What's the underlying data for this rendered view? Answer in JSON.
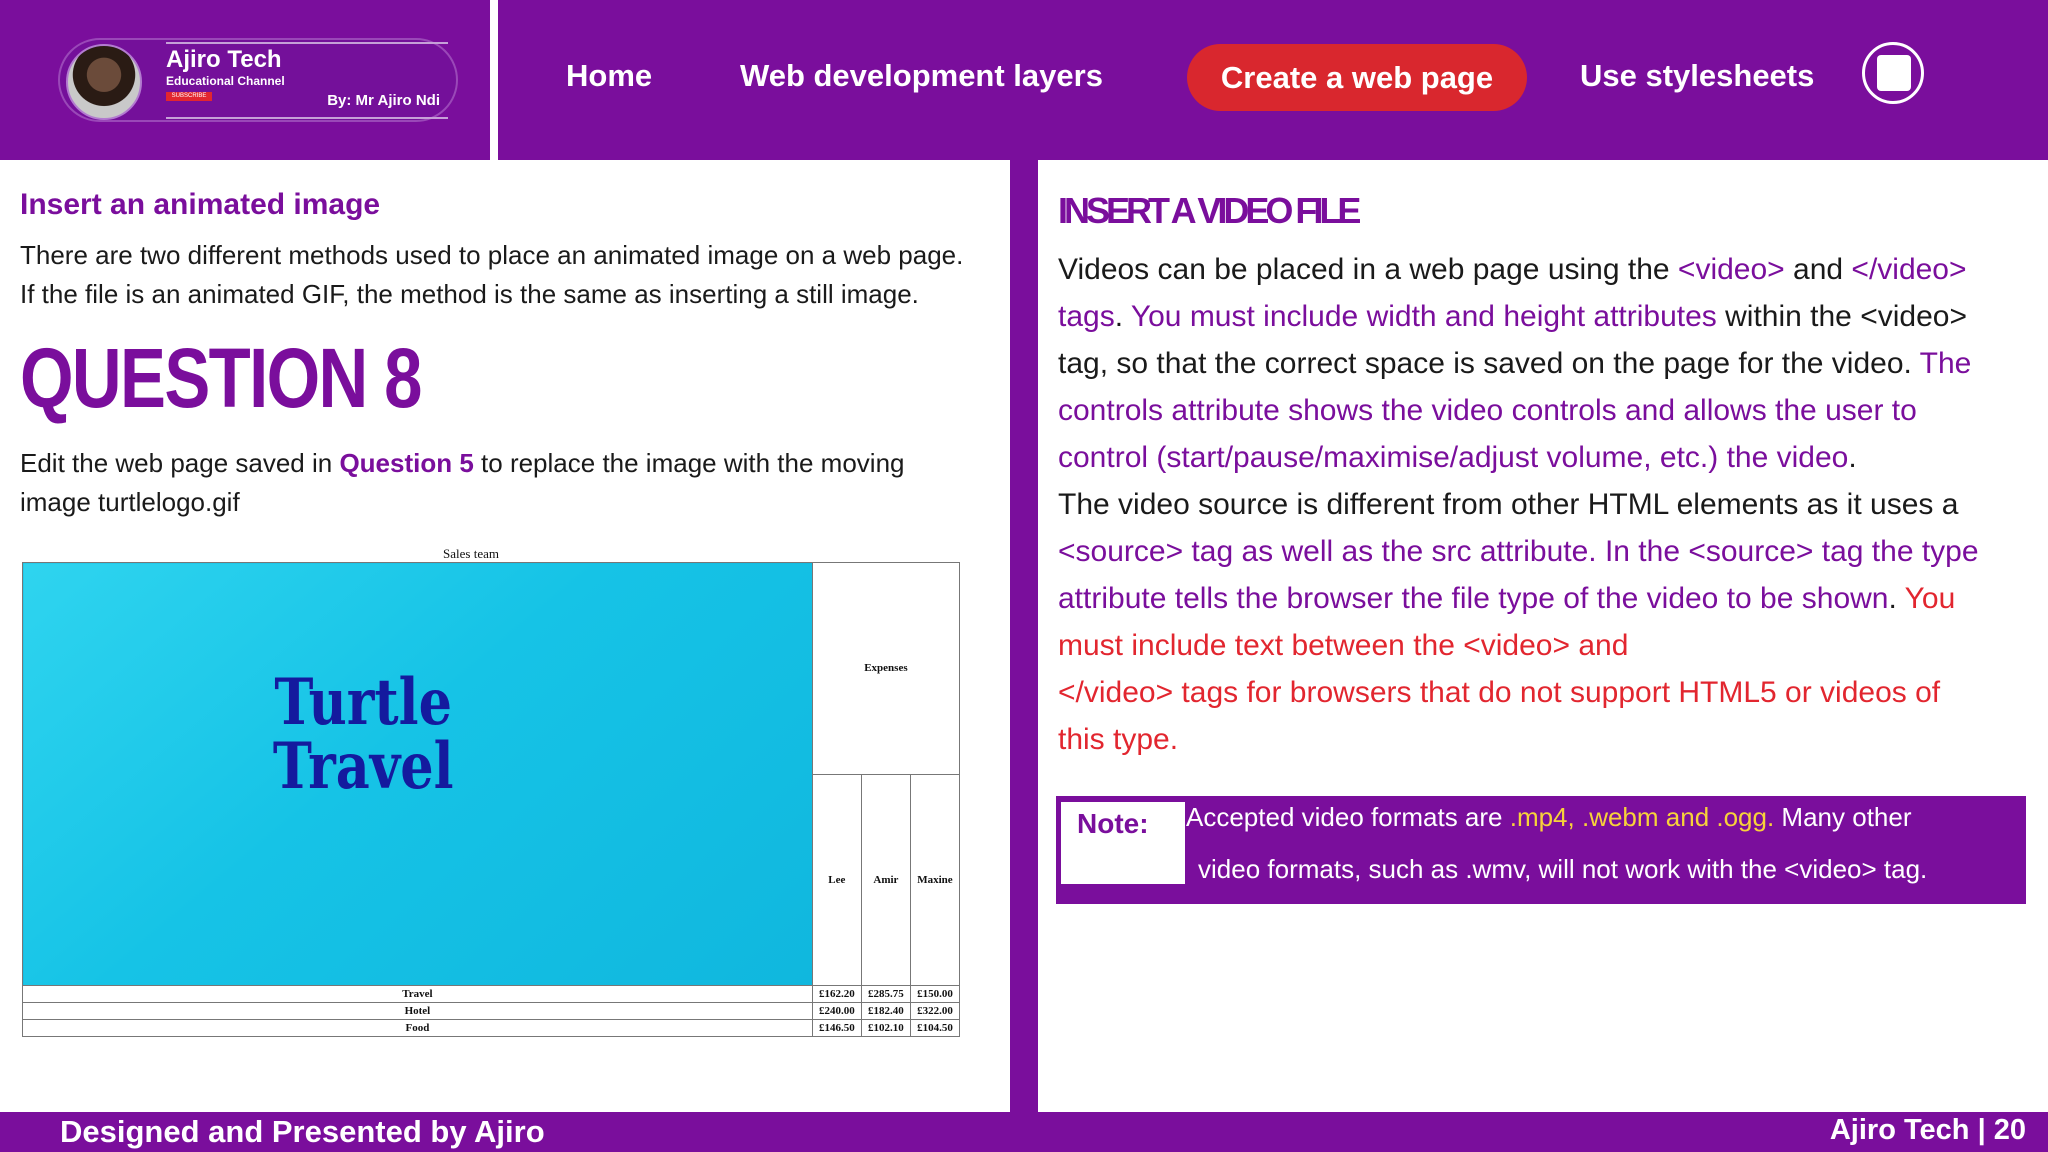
{
  "brand": {
    "name": "Ajiro Tech",
    "subtitle": "Educational Channel",
    "subscribe": "SUBSCRIBE",
    "byline": "By: Mr Ajiro Ndi"
  },
  "nav": {
    "home": "Home",
    "layers": "Web development layers",
    "create": "Create a web page",
    "stylesheets": "Use stylesheets"
  },
  "left": {
    "heading": "Insert an animated image",
    "para1": "There are two different methods used to place an animated image on a web page.",
    "para2": "If the file is an animated GIF, the method is the same as inserting a still image.",
    "question": "QUESTION 8",
    "edit_pre": "Edit the web page saved in ",
    "edit_q": "Question 5",
    "edit_post": " to replace the image with the moving",
    "edit_line2": "image turtlelogo.gif",
    "table": {
      "caption": "Sales team",
      "image_text1": "Turtle",
      "image_text2": "Travel",
      "expenses": "Expenses",
      "people": [
        "Lee",
        "Amir",
        "Maxine"
      ],
      "rows": [
        {
          "label": "Travel",
          "values": [
            "£162.20",
            "£285.75",
            "£150.00"
          ]
        },
        {
          "label": "Hotel",
          "values": [
            "£240.00",
            "£182.40",
            "£322.00"
          ]
        },
        {
          "label": "Food",
          "values": [
            "£146.50",
            "£102.10",
            "£104.50"
          ]
        }
      ]
    }
  },
  "right": {
    "heading": "INSERT A VIDEO FILE",
    "p1a": "Videos can be placed in a web page using the ",
    "p1b": "<video>",
    "p1c": " and ",
    "p1d": "</video>",
    "p2a": "tags",
    "p2b": ". ",
    "p2c": "You must include width and height attributes",
    "p2d": " within the <video>",
    "p3a": "tag, so that the correct space is saved on the page for the video. ",
    "p3b": "The",
    "p4": "controls attribute shows the video controls and allows the user to",
    "p5a": "control (start/pause/maximise/adjust volume, etc.) the video",
    "p5b": ".",
    "p6": "The video source is different from other HTML elements as it uses a",
    "p7": "<source> tag as well as the src attribute. In the <source> tag the type",
    "p8a": "attribute tells the browser the file type of the video to be shown",
    "p8b": ". ",
    "p8c": "You",
    "p9": "must include text between the <video> and",
    "p10": "</video> tags for browsers that do not support HTML5 or videos of",
    "p11": "this type.",
    "note_label": "Note:",
    "note1a": "Accepted video formats are ",
    "note1b": ".mp4, .webm and .ogg.",
    "note1c": " Many other",
    "note2": "video formats, such as .wmv, will not work with the <video> tag."
  },
  "footer": {
    "left": "Designed and Presented by Ajiro",
    "right": "Ajiro Tech | 20"
  }
}
